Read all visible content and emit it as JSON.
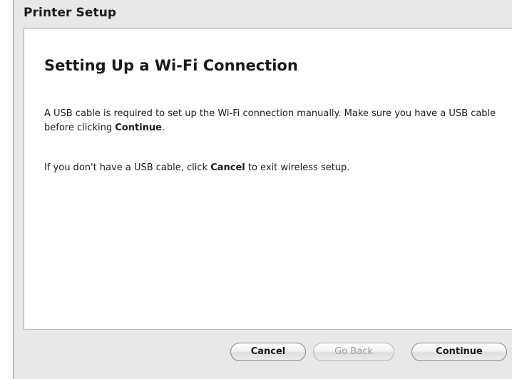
{
  "window": {
    "title": "Printer Setup"
  },
  "panel": {
    "heading": "Setting Up a Wi-Fi Connection",
    "paragraph1": {
      "text_before": "A USB cable is required to set up the Wi-Fi connection manually. Make sure you have a USB cable before clicking ",
      "bold": "Continue",
      "text_after": "."
    },
    "paragraph2": {
      "text_before": "If you don't have a USB cable, click ",
      "bold": "Cancel",
      "text_after": " to exit wireless setup."
    }
  },
  "buttons": {
    "cancel": "Cancel",
    "go_back": "Go Back",
    "continue": "Continue"
  },
  "state": {
    "go_back_enabled": false
  },
  "colors": {
    "window_bg": "#e8e8e8",
    "panel_bg": "#ffffff",
    "disabled_text": "#9d9d9d"
  }
}
